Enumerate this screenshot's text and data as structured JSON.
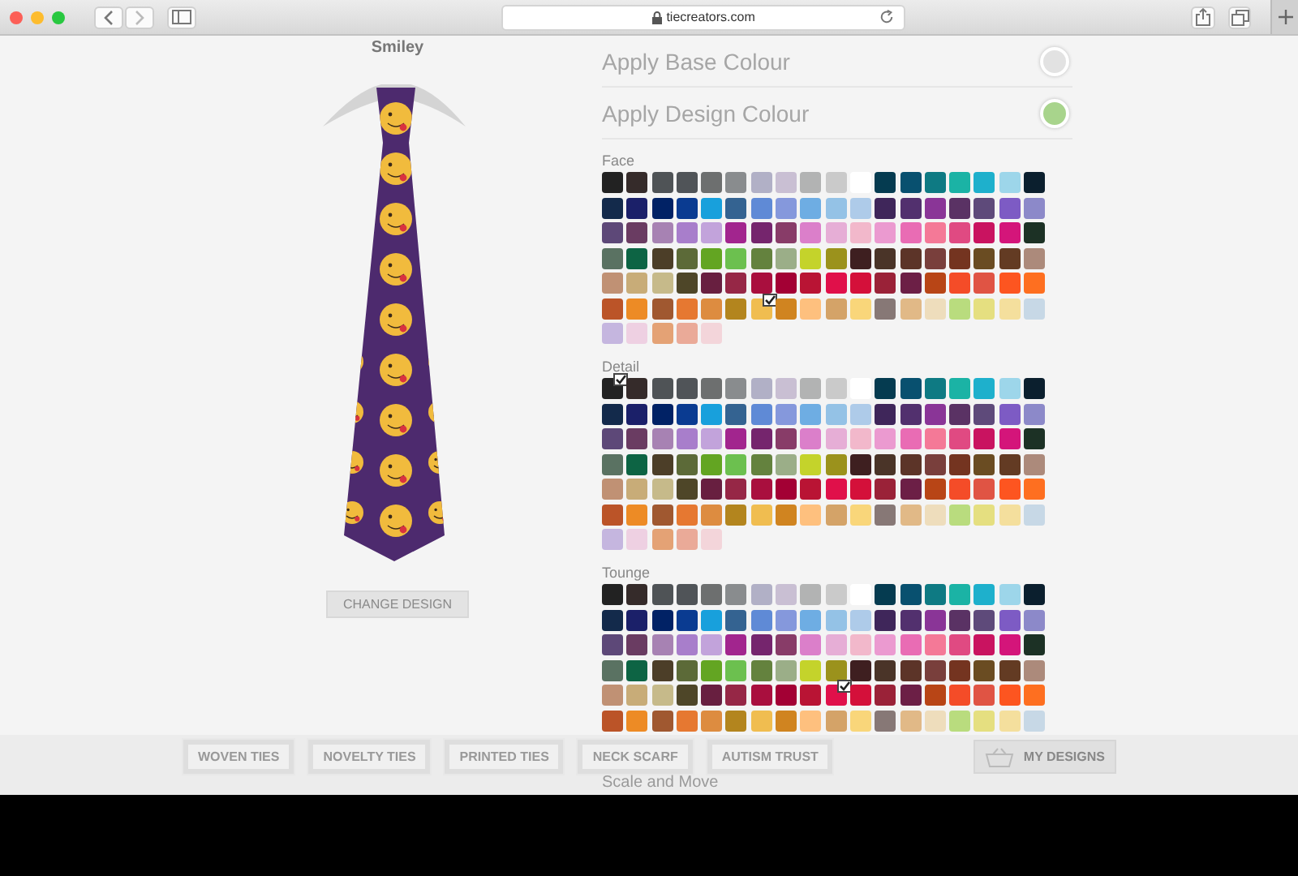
{
  "browser": {
    "url": "tiecreators.com"
  },
  "design": {
    "title": "Smiley",
    "change_button": "CHANGE DESIGN"
  },
  "options": [
    {
      "label": "Apply Base Colour",
      "on": false
    },
    {
      "label": "Apply Design Colour",
      "on": true
    }
  ],
  "groups": [
    {
      "label": "Face",
      "swatches": [
        {
          "color": "#222222",
          "selected": false
        },
        {
          "color": "#352b2a",
          "selected": false
        },
        {
          "color": "#4f5356",
          "selected": false
        },
        {
          "color": "#505458",
          "selected": false
        },
        {
          "color": "#6d6f6f",
          "selected": false
        },
        {
          "color": "#898c8e",
          "selected": false
        },
        {
          "color": "#b1b0c6",
          "selected": false
        },
        {
          "color": "#c9bfd3",
          "selected": false
        },
        {
          "color": "#b2b3b3",
          "selected": false
        },
        {
          "color": "#cacaca",
          "selected": false
        },
        {
          "color": "#ffffff",
          "selected": false
        },
        {
          "color": "#053b50",
          "selected": false
        },
        {
          "color": "#08506f",
          "selected": false
        },
        {
          "color": "#0e7a83",
          "selected": false
        },
        {
          "color": "#1bb3a5",
          "selected": false
        },
        {
          "color": "#1eb0cc",
          "selected": false
        },
        {
          "color": "#9dd6ea",
          "selected": false
        },
        {
          "color": "#0b1f2e",
          "selected": false
        },
        {
          "color": "#132a4b",
          "selected": false
        },
        {
          "color": "#1b2069",
          "selected": false
        },
        {
          "color": "#012265",
          "selected": false
        },
        {
          "color": "#0a3b91",
          "selected": false
        },
        {
          "color": "#18a0dc",
          "selected": false
        },
        {
          "color": "#346391",
          "selected": false
        },
        {
          "color": "#5f8ad6",
          "selected": false
        },
        {
          "color": "#8598dc",
          "selected": false
        },
        {
          "color": "#6eade3",
          "selected": false
        },
        {
          "color": "#94c2e6",
          "selected": false
        },
        {
          "color": "#aecbe9",
          "selected": false
        },
        {
          "color": "#3f265a",
          "selected": false
        },
        {
          "color": "#52306e",
          "selected": false
        },
        {
          "color": "#8a3597",
          "selected": false
        },
        {
          "color": "#5a3264",
          "selected": false
        },
        {
          "color": "#5e4a7a",
          "selected": false
        },
        {
          "color": "#7d5bc4",
          "selected": false
        },
        {
          "color": "#8c89c9",
          "selected": false
        },
        {
          "color": "#5d4878",
          "selected": false
        },
        {
          "color": "#6a3c62",
          "selected": false
        },
        {
          "color": "#a782b3",
          "selected": false
        },
        {
          "color": "#a87ecb",
          "selected": false
        },
        {
          "color": "#c2a3db",
          "selected": false
        },
        {
          "color": "#a2258e",
          "selected": false
        },
        {
          "color": "#75256d",
          "selected": false
        },
        {
          "color": "#883c68",
          "selected": false
        },
        {
          "color": "#db7fca",
          "selected": false
        },
        {
          "color": "#e6aed6",
          "selected": false
        },
        {
          "color": "#f2b8cb",
          "selected": false
        },
        {
          "color": "#eb9ad0",
          "selected": false
        },
        {
          "color": "#e96cb4",
          "selected": false
        },
        {
          "color": "#f47997",
          "selected": false
        },
        {
          "color": "#e04a82",
          "selected": false
        },
        {
          "color": "#c91360",
          "selected": false
        },
        {
          "color": "#d4157a",
          "selected": false
        },
        {
          "color": "#1c3125",
          "selected": false
        },
        {
          "color": "#5a7262",
          "selected": false
        },
        {
          "color": "#0d6444",
          "selected": false
        },
        {
          "color": "#4c3e28",
          "selected": false
        },
        {
          "color": "#5c6a38",
          "selected": false
        },
        {
          "color": "#63a522",
          "selected": false
        },
        {
          "color": "#6cc04f",
          "selected": false
        },
        {
          "color": "#64823e",
          "selected": false
        },
        {
          "color": "#9bae88",
          "selected": false
        },
        {
          "color": "#c4d32b",
          "selected": false
        },
        {
          "color": "#9b921c",
          "selected": false
        },
        {
          "color": "#3e1f20",
          "selected": false
        },
        {
          "color": "#4a3428",
          "selected": false
        },
        {
          "color": "#5c3428",
          "selected": false
        },
        {
          "color": "#793f3c",
          "selected": false
        },
        {
          "color": "#743420",
          "selected": false
        },
        {
          "color": "#6a4c22",
          "selected": false
        },
        {
          "color": "#633b23",
          "selected": false
        },
        {
          "color": "#ac8a7b",
          "selected": false
        },
        {
          "color": "#c09174",
          "selected": false
        },
        {
          "color": "#c8ac78",
          "selected": false
        },
        {
          "color": "#c6ba8a",
          "selected": false
        },
        {
          "color": "#4e4628",
          "selected": false
        },
        {
          "color": "#681f40",
          "selected": false
        },
        {
          "color": "#962746",
          "selected": false
        },
        {
          "color": "#a90f3e",
          "selected": false
        },
        {
          "color": "#a30034",
          "selected": false
        },
        {
          "color": "#b91434",
          "selected": false
        },
        {
          "color": "#e0104a",
          "selected": false
        },
        {
          "color": "#d4103a",
          "selected": false
        },
        {
          "color": "#9a2238",
          "selected": false
        },
        {
          "color": "#6c1f46",
          "selected": false
        },
        {
          "color": "#b84516",
          "selected": false
        },
        {
          "color": "#f44c28",
          "selected": false
        },
        {
          "color": "#e05444",
          "selected": false
        },
        {
          "color": "#fd5520",
          "selected": false
        },
        {
          "color": "#fe6f20",
          "selected": false
        },
        {
          "color": "#bb5428",
          "selected": false
        },
        {
          "color": "#ed8b25",
          "selected": false
        },
        {
          "color": "#a05830",
          "selected": false
        },
        {
          "color": "#e67831",
          "selected": false
        },
        {
          "color": "#dd8c40",
          "selected": false
        },
        {
          "color": "#b3851e",
          "selected": false
        },
        {
          "color": "#f0bd50",
          "selected": true
        },
        {
          "color": "#d08420",
          "selected": false
        },
        {
          "color": "#fec07e",
          "selected": false
        },
        {
          "color": "#d4a368",
          "selected": false
        },
        {
          "color": "#f9d67a",
          "selected": false
        },
        {
          "color": "#877876",
          "selected": false
        },
        {
          "color": "#e1b987",
          "selected": false
        },
        {
          "color": "#eeddbc",
          "selected": false
        },
        {
          "color": "#b9dc7e",
          "selected": false
        },
        {
          "color": "#e5df80",
          "selected": false
        },
        {
          "color": "#f4df9d",
          "selected": false
        },
        {
          "color": "#c7d8e6",
          "selected": false
        },
        {
          "color": "#c5b6df",
          "selected": false
        },
        {
          "color": "#eed0e2",
          "selected": false
        },
        {
          "color": "#e4a275",
          "selected": false
        },
        {
          "color": "#eaaa98",
          "selected": false
        },
        {
          "color": "#f3d5da",
          "selected": false
        }
      ]
    },
    {
      "label": "Detail",
      "swatches": [
        {
          "color": "#222222",
          "selected": true
        },
        {
          "color": "#352b2a",
          "selected": false
        },
        {
          "color": "#4f5356",
          "selected": false
        },
        {
          "color": "#505458",
          "selected": false
        },
        {
          "color": "#6d6f6f",
          "selected": false
        },
        {
          "color": "#898c8e",
          "selected": false
        },
        {
          "color": "#b1b0c6",
          "selected": false
        },
        {
          "color": "#c9bfd3",
          "selected": false
        },
        {
          "color": "#b2b3b3",
          "selected": false
        },
        {
          "color": "#cacaca",
          "selected": false
        },
        {
          "color": "#ffffff",
          "selected": false
        },
        {
          "color": "#053b50",
          "selected": false
        },
        {
          "color": "#08506f",
          "selected": false
        },
        {
          "color": "#0e7a83",
          "selected": false
        },
        {
          "color": "#1bb3a5",
          "selected": false
        },
        {
          "color": "#1eb0cc",
          "selected": false
        },
        {
          "color": "#9dd6ea",
          "selected": false
        },
        {
          "color": "#0b1f2e",
          "selected": false
        },
        {
          "color": "#132a4b",
          "selected": false
        },
        {
          "color": "#1b2069",
          "selected": false
        },
        {
          "color": "#012265",
          "selected": false
        },
        {
          "color": "#0a3b91",
          "selected": false
        },
        {
          "color": "#18a0dc",
          "selected": false
        },
        {
          "color": "#346391",
          "selected": false
        },
        {
          "color": "#5f8ad6",
          "selected": false
        },
        {
          "color": "#8598dc",
          "selected": false
        },
        {
          "color": "#6eade3",
          "selected": false
        },
        {
          "color": "#94c2e6",
          "selected": false
        },
        {
          "color": "#aecbe9",
          "selected": false
        },
        {
          "color": "#3f265a",
          "selected": false
        },
        {
          "color": "#52306e",
          "selected": false
        },
        {
          "color": "#8a3597",
          "selected": false
        },
        {
          "color": "#5a3264",
          "selected": false
        },
        {
          "color": "#5e4a7a",
          "selected": false
        },
        {
          "color": "#7d5bc4",
          "selected": false
        },
        {
          "color": "#8c89c9",
          "selected": false
        },
        {
          "color": "#5d4878",
          "selected": false
        },
        {
          "color": "#6a3c62",
          "selected": false
        },
        {
          "color": "#a782b3",
          "selected": false
        },
        {
          "color": "#a87ecb",
          "selected": false
        },
        {
          "color": "#c2a3db",
          "selected": false
        },
        {
          "color": "#a2258e",
          "selected": false
        },
        {
          "color": "#75256d",
          "selected": false
        },
        {
          "color": "#883c68",
          "selected": false
        },
        {
          "color": "#db7fca",
          "selected": false
        },
        {
          "color": "#e6aed6",
          "selected": false
        },
        {
          "color": "#f2b8cb",
          "selected": false
        },
        {
          "color": "#eb9ad0",
          "selected": false
        },
        {
          "color": "#e96cb4",
          "selected": false
        },
        {
          "color": "#f47997",
          "selected": false
        },
        {
          "color": "#e04a82",
          "selected": false
        },
        {
          "color": "#c91360",
          "selected": false
        },
        {
          "color": "#d4157a",
          "selected": false
        },
        {
          "color": "#1c3125",
          "selected": false
        },
        {
          "color": "#5a7262",
          "selected": false
        },
        {
          "color": "#0d6444",
          "selected": false
        },
        {
          "color": "#4c3e28",
          "selected": false
        },
        {
          "color": "#5c6a38",
          "selected": false
        },
        {
          "color": "#63a522",
          "selected": false
        },
        {
          "color": "#6cc04f",
          "selected": false
        },
        {
          "color": "#64823e",
          "selected": false
        },
        {
          "color": "#9bae88",
          "selected": false
        },
        {
          "color": "#c4d32b",
          "selected": false
        },
        {
          "color": "#9b921c",
          "selected": false
        },
        {
          "color": "#3e1f20",
          "selected": false
        },
        {
          "color": "#4a3428",
          "selected": false
        },
        {
          "color": "#5c3428",
          "selected": false
        },
        {
          "color": "#793f3c",
          "selected": false
        },
        {
          "color": "#743420",
          "selected": false
        },
        {
          "color": "#6a4c22",
          "selected": false
        },
        {
          "color": "#633b23",
          "selected": false
        },
        {
          "color": "#ac8a7b",
          "selected": false
        },
        {
          "color": "#c09174",
          "selected": false
        },
        {
          "color": "#c8ac78",
          "selected": false
        },
        {
          "color": "#c6ba8a",
          "selected": false
        },
        {
          "color": "#4e4628",
          "selected": false
        },
        {
          "color": "#681f40",
          "selected": false
        },
        {
          "color": "#962746",
          "selected": false
        },
        {
          "color": "#a90f3e",
          "selected": false
        },
        {
          "color": "#a30034",
          "selected": false
        },
        {
          "color": "#b91434",
          "selected": false
        },
        {
          "color": "#e0104a",
          "selected": false
        },
        {
          "color": "#d4103a",
          "selected": false
        },
        {
          "color": "#9a2238",
          "selected": false
        },
        {
          "color": "#6c1f46",
          "selected": false
        },
        {
          "color": "#b84516",
          "selected": false
        },
        {
          "color": "#f44c28",
          "selected": false
        },
        {
          "color": "#e05444",
          "selected": false
        },
        {
          "color": "#fd5520",
          "selected": false
        },
        {
          "color": "#fe6f20",
          "selected": false
        },
        {
          "color": "#bb5428",
          "selected": false
        },
        {
          "color": "#ed8b25",
          "selected": false
        },
        {
          "color": "#a05830",
          "selected": false
        },
        {
          "color": "#e67831",
          "selected": false
        },
        {
          "color": "#dd8c40",
          "selected": false
        },
        {
          "color": "#b3851e",
          "selected": false
        },
        {
          "color": "#f0bd50",
          "selected": false
        },
        {
          "color": "#d08420",
          "selected": false
        },
        {
          "color": "#fec07e",
          "selected": false
        },
        {
          "color": "#d4a368",
          "selected": false
        },
        {
          "color": "#f9d67a",
          "selected": false
        },
        {
          "color": "#877876",
          "selected": false
        },
        {
          "color": "#e1b987",
          "selected": false
        },
        {
          "color": "#eeddbc",
          "selected": false
        },
        {
          "color": "#b9dc7e",
          "selected": false
        },
        {
          "color": "#e5df80",
          "selected": false
        },
        {
          "color": "#f4df9d",
          "selected": false
        },
        {
          "color": "#c7d8e6",
          "selected": false
        },
        {
          "color": "#c5b6df",
          "selected": false
        },
        {
          "color": "#eed0e2",
          "selected": false
        },
        {
          "color": "#e4a275",
          "selected": false
        },
        {
          "color": "#eaaa98",
          "selected": false
        },
        {
          "color": "#f3d5da",
          "selected": false
        }
      ]
    },
    {
      "label": "Tounge",
      "swatches": [
        {
          "color": "#222222",
          "selected": false
        },
        {
          "color": "#352b2a",
          "selected": false
        },
        {
          "color": "#4f5356",
          "selected": false
        },
        {
          "color": "#505458",
          "selected": false
        },
        {
          "color": "#6d6f6f",
          "selected": false
        },
        {
          "color": "#898c8e",
          "selected": false
        },
        {
          "color": "#b1b0c6",
          "selected": false
        },
        {
          "color": "#c9bfd3",
          "selected": false
        },
        {
          "color": "#b2b3b3",
          "selected": false
        },
        {
          "color": "#cacaca",
          "selected": false
        },
        {
          "color": "#ffffff",
          "selected": false
        },
        {
          "color": "#053b50",
          "selected": false
        },
        {
          "color": "#08506f",
          "selected": false
        },
        {
          "color": "#0e7a83",
          "selected": false
        },
        {
          "color": "#1bb3a5",
          "selected": false
        },
        {
          "color": "#1eb0cc",
          "selected": false
        },
        {
          "color": "#9dd6ea",
          "selected": false
        },
        {
          "color": "#0b1f2e",
          "selected": false
        },
        {
          "color": "#132a4b",
          "selected": false
        },
        {
          "color": "#1b2069",
          "selected": false
        },
        {
          "color": "#012265",
          "selected": false
        },
        {
          "color": "#0a3b91",
          "selected": false
        },
        {
          "color": "#18a0dc",
          "selected": false
        },
        {
          "color": "#346391",
          "selected": false
        },
        {
          "color": "#5f8ad6",
          "selected": false
        },
        {
          "color": "#8598dc",
          "selected": false
        },
        {
          "color": "#6eade3",
          "selected": false
        },
        {
          "color": "#94c2e6",
          "selected": false
        },
        {
          "color": "#aecbe9",
          "selected": false
        },
        {
          "color": "#3f265a",
          "selected": false
        },
        {
          "color": "#52306e",
          "selected": false
        },
        {
          "color": "#8a3597",
          "selected": false
        },
        {
          "color": "#5a3264",
          "selected": false
        },
        {
          "color": "#5e4a7a",
          "selected": false
        },
        {
          "color": "#7d5bc4",
          "selected": false
        },
        {
          "color": "#8c89c9",
          "selected": false
        },
        {
          "color": "#5d4878",
          "selected": false
        },
        {
          "color": "#6a3c62",
          "selected": false
        },
        {
          "color": "#a782b3",
          "selected": false
        },
        {
          "color": "#a87ecb",
          "selected": false
        },
        {
          "color": "#c2a3db",
          "selected": false
        },
        {
          "color": "#a2258e",
          "selected": false
        },
        {
          "color": "#75256d",
          "selected": false
        },
        {
          "color": "#883c68",
          "selected": false
        },
        {
          "color": "#db7fca",
          "selected": false
        },
        {
          "color": "#e6aed6",
          "selected": false
        },
        {
          "color": "#f2b8cb",
          "selected": false
        },
        {
          "color": "#eb9ad0",
          "selected": false
        },
        {
          "color": "#e96cb4",
          "selected": false
        },
        {
          "color": "#f47997",
          "selected": false
        },
        {
          "color": "#e04a82",
          "selected": false
        },
        {
          "color": "#c91360",
          "selected": false
        },
        {
          "color": "#d4157a",
          "selected": false
        },
        {
          "color": "#1c3125",
          "selected": false
        },
        {
          "color": "#5a7262",
          "selected": false
        },
        {
          "color": "#0d6444",
          "selected": false
        },
        {
          "color": "#4c3e28",
          "selected": false
        },
        {
          "color": "#5c6a38",
          "selected": false
        },
        {
          "color": "#63a522",
          "selected": false
        },
        {
          "color": "#6cc04f",
          "selected": false
        },
        {
          "color": "#64823e",
          "selected": false
        },
        {
          "color": "#9bae88",
          "selected": false
        },
        {
          "color": "#c4d32b",
          "selected": false
        },
        {
          "color": "#9b921c",
          "selected": false
        },
        {
          "color": "#3e1f20",
          "selected": false
        },
        {
          "color": "#4a3428",
          "selected": false
        },
        {
          "color": "#5c3428",
          "selected": false
        },
        {
          "color": "#793f3c",
          "selected": false
        },
        {
          "color": "#743420",
          "selected": false
        },
        {
          "color": "#6a4c22",
          "selected": false
        },
        {
          "color": "#633b23",
          "selected": false
        },
        {
          "color": "#ac8a7b",
          "selected": false
        },
        {
          "color": "#c09174",
          "selected": false
        },
        {
          "color": "#c8ac78",
          "selected": false
        },
        {
          "color": "#c6ba8a",
          "selected": false
        },
        {
          "color": "#4e4628",
          "selected": false
        },
        {
          "color": "#681f40",
          "selected": false
        },
        {
          "color": "#962746",
          "selected": false
        },
        {
          "color": "#a90f3e",
          "selected": false
        },
        {
          "color": "#a30034",
          "selected": false
        },
        {
          "color": "#b91434",
          "selected": false
        },
        {
          "color": "#e0104a",
          "selected": true
        },
        {
          "color": "#d4103a",
          "selected": false
        },
        {
          "color": "#9a2238",
          "selected": false
        },
        {
          "color": "#6c1f46",
          "selected": false
        },
        {
          "color": "#b84516",
          "selected": false
        },
        {
          "color": "#f44c28",
          "selected": false
        },
        {
          "color": "#e05444",
          "selected": false
        },
        {
          "color": "#fd5520",
          "selected": false
        },
        {
          "color": "#fe6f20",
          "selected": false
        },
        {
          "color": "#bb5428",
          "selected": false
        },
        {
          "color": "#ed8b25",
          "selected": false
        },
        {
          "color": "#a05830",
          "selected": false
        },
        {
          "color": "#e67831",
          "selected": false
        },
        {
          "color": "#dd8c40",
          "selected": false
        },
        {
          "color": "#b3851e",
          "selected": false
        },
        {
          "color": "#f0bd50",
          "selected": false
        },
        {
          "color": "#d08420",
          "selected": false
        },
        {
          "color": "#fec07e",
          "selected": false
        },
        {
          "color": "#d4a368",
          "selected": false
        },
        {
          "color": "#f9d67a",
          "selected": false
        },
        {
          "color": "#877876",
          "selected": false
        },
        {
          "color": "#e1b987",
          "selected": false
        },
        {
          "color": "#eeddbc",
          "selected": false
        },
        {
          "color": "#b9dc7e",
          "selected": false
        },
        {
          "color": "#e5df80",
          "selected": false
        },
        {
          "color": "#f4df9d",
          "selected": false
        },
        {
          "color": "#c7d8e6",
          "selected": false
        }
      ]
    }
  ],
  "next_section": "Scale and Move",
  "nav": [
    "WOVEN TIES",
    "NOVELTY TIES",
    "PRINTED TIES",
    "NECK SCARF",
    "AUTISM TRUST"
  ],
  "my_designs": "MY DESIGNS"
}
